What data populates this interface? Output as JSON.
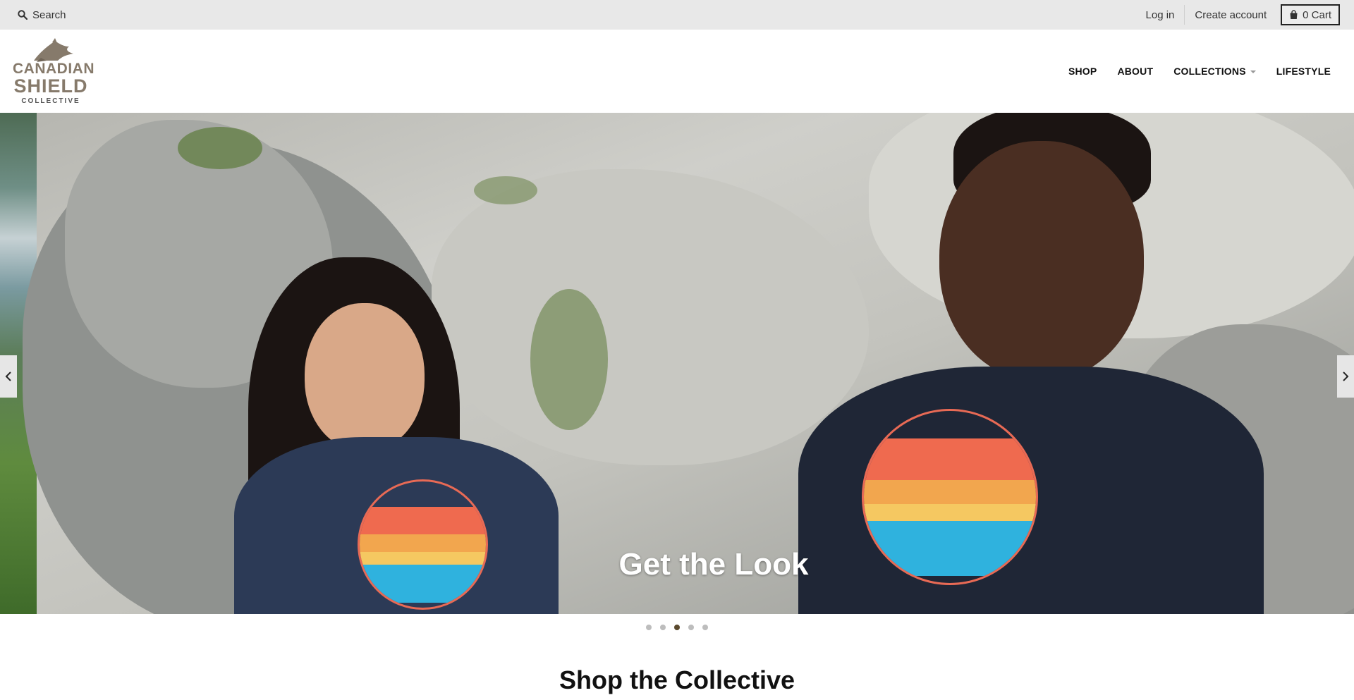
{
  "utility_bar": {
    "search_label": "Search",
    "login_label": "Log in",
    "create_account_label": "Create account",
    "cart_label": "0 Cart"
  },
  "header": {
    "logo": {
      "line1": "CANADIAN",
      "line2": "SHIELD",
      "line3": "COLLECTIVE"
    },
    "nav": [
      {
        "label": "SHOP"
      },
      {
        "label": "ABOUT"
      },
      {
        "label": "COLLECTIONS",
        "has_dropdown": true
      },
      {
        "label": "LIFESTYLE"
      }
    ]
  },
  "hero": {
    "caption": "Get the Look",
    "slides_count": 5,
    "active_slide": 3,
    "prev_arrow_icon": "chevron-left-icon",
    "next_arrow_icon": "chevron-right-icon"
  },
  "main": {
    "section_title": "Shop the Collective"
  },
  "colors": {
    "utility_bar_bg": "#e8e8e8",
    "logo_color": "#867a6b",
    "active_dot": "#5b4a2e",
    "inactive_dot": "#bdbdbd"
  }
}
